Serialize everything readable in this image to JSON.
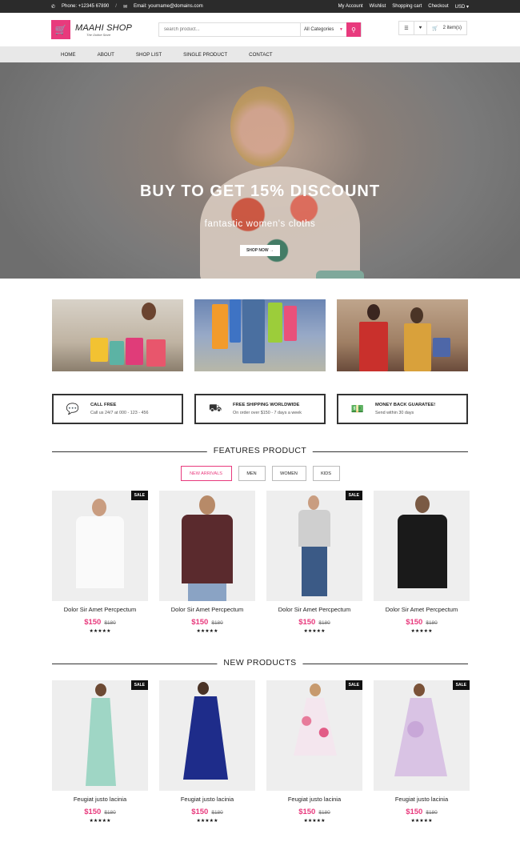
{
  "topbar": {
    "phone": "Phone: +12345 67890",
    "divider": "/",
    "email": "Email: yourname@domains.com",
    "links": [
      "My Account",
      "Wishlist",
      "Shopping cart",
      "Checkout",
      "USD"
    ]
  },
  "header": {
    "logo_name": "MAAHI SHOP",
    "logo_tag": "The Online Store",
    "search_placeholder": "search product...",
    "category": "All Categories",
    "cart_count": "2 item(s)"
  },
  "nav": [
    "HOME",
    "ABOUT",
    "SHOP LIST",
    "SINGLE PRODUCT",
    "CONTACT"
  ],
  "hero": {
    "title": "BUY TO GET 15% DISCOUNT",
    "subtitle": "fantastic women's cloths",
    "button": "SHOP NOW"
  },
  "features": [
    {
      "title": "CALL FREE",
      "desc": "Call us 24/7 at 000 - 123 - 456",
      "icon": "chat-icon"
    },
    {
      "title": "FREE SHIPPING WORLDWIDE",
      "desc": "On order over $150 - 7 days a week",
      "icon": "truck-icon"
    },
    {
      "title": "MONEY BACK GUARATEE!",
      "desc": "Send within 30 days",
      "icon": "money-icon"
    }
  ],
  "featured": {
    "title": "FEATURES PRODUCT",
    "tabs": [
      "NEW ARRIVALS",
      "MEN",
      "WOMEN",
      "KIDS"
    ],
    "products": [
      {
        "name": "Dolor Sir Amet Percpectum",
        "price": "$150",
        "old_price": "$180",
        "sale": "SALE",
        "stars": "★★★★★"
      },
      {
        "name": "Dolor Sir Amet Percpectum",
        "price": "$150",
        "old_price": "$180",
        "sale": "",
        "stars": "★★★★★"
      },
      {
        "name": "Dolor Sir Amet Percpectum",
        "price": "$150",
        "old_price": "$180",
        "sale": "SALE",
        "stars": "★★★★★"
      },
      {
        "name": "Dolor Sir Amet Percpectum",
        "price": "$150",
        "old_price": "$180",
        "sale": "",
        "stars": "★★★★★"
      }
    ]
  },
  "newproducts": {
    "title": "NEW PRODUCTS",
    "products": [
      {
        "name": "Feugiat justo lacinia",
        "price": "$150",
        "old_price": "$180",
        "sale": "SALE",
        "stars": "★★★★★"
      },
      {
        "name": "Feugiat justo lacinia",
        "price": "$150",
        "old_price": "$180",
        "sale": "",
        "stars": "★★★★★"
      },
      {
        "name": "Feugiat justo lacinia",
        "price": "$150",
        "old_price": "$180",
        "sale": "SALE",
        "stars": "★★★★★"
      },
      {
        "name": "Feugiat justo lacinia",
        "price": "$150",
        "old_price": "$180",
        "sale": "SALE",
        "stars": "★★★★★"
      }
    ]
  }
}
